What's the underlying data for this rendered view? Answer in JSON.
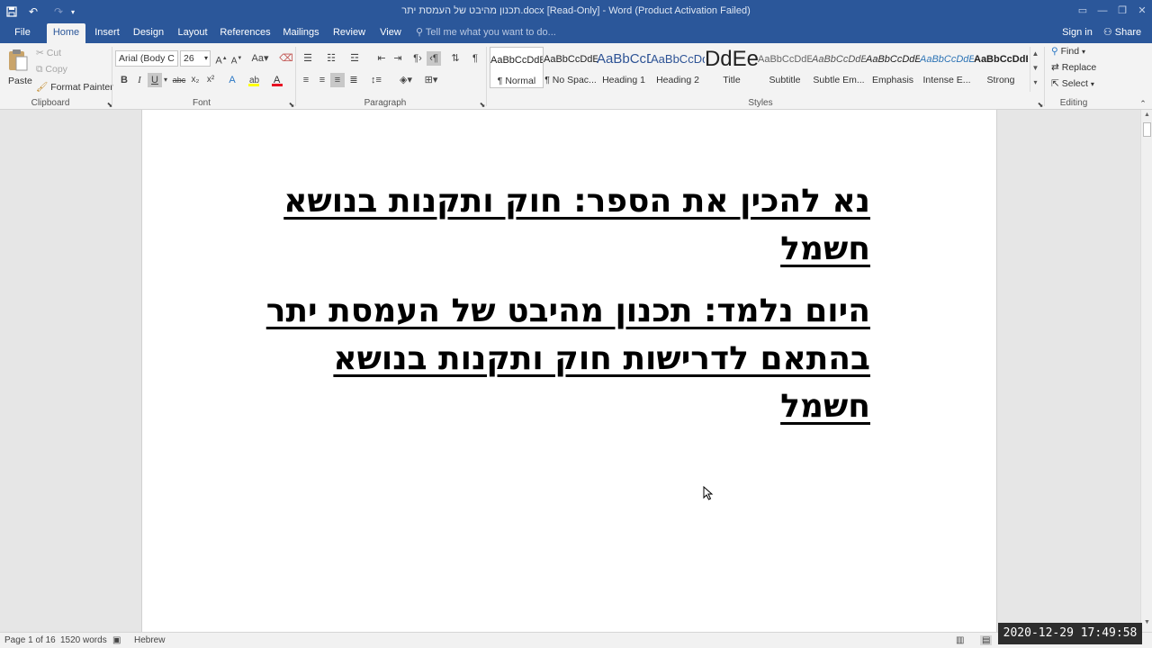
{
  "window": {
    "title": "תכנון מהיבט של העמסת יתר.docx [Read-Only] - Word (Product Activation Failed)"
  },
  "tabs": [
    "File",
    "Home",
    "Insert",
    "Design",
    "Layout",
    "References",
    "Mailings",
    "Review",
    "View"
  ],
  "tell_me": "Tell me what you want to do...",
  "account": {
    "sign_in": "Sign in",
    "share": "Share"
  },
  "clipboard": {
    "paste": "Paste",
    "cut": "Cut",
    "copy": "Copy",
    "format_painter": "Format Painter",
    "label": "Clipboard"
  },
  "font": {
    "name": "Arial (Body C",
    "size": "26",
    "label": "Font",
    "bold": "B",
    "italic": "I",
    "underline": "U"
  },
  "paragraph": {
    "label": "Paragraph"
  },
  "styles": {
    "label": "Styles",
    "items": [
      {
        "preview": "AaBbCcDdEe",
        "name": "¶ Normal"
      },
      {
        "preview": "AaBbCcDdEe",
        "name": "¶ No Spac..."
      },
      {
        "preview": "AaBbCcDdEe",
        "name": "Heading 1"
      },
      {
        "preview": "AaBbCcDdEe",
        "name": "Heading 2"
      },
      {
        "preview": "AaBbCcDdEe",
        "name": "Title"
      },
      {
        "preview": "AaBbCcDdEe",
        "name": "Subtitle"
      },
      {
        "preview": "AaBbCcDdEe",
        "name": "Subtle Em..."
      },
      {
        "preview": "AaBbCcDdEe",
        "name": "Emphasis"
      },
      {
        "preview": "AaBbCcDdEe",
        "name": "Intense E..."
      },
      {
        "preview": "AaBbCcDdEe",
        "name": "Strong"
      }
    ]
  },
  "editing": {
    "label": "Editing",
    "find": "Find",
    "replace": "Replace",
    "select": "Select"
  },
  "document": {
    "paragraphs": [
      "נא להכין את הספר: חוק ותקנות בנושא חשמל",
      "היום נלמד: תכנון מהיבט של העמסת יתר בהתאם לדרישות חוק ותקנות בנושא חשמל"
    ]
  },
  "status": {
    "page": "Page 1 of 16",
    "words": "1520 words",
    "language": "Hebrew"
  },
  "clock": "2020-12-29  17:49:58",
  "colors": {
    "accent": "#2b579a",
    "font_color": "#e81123",
    "highlight": "#ffff00"
  }
}
